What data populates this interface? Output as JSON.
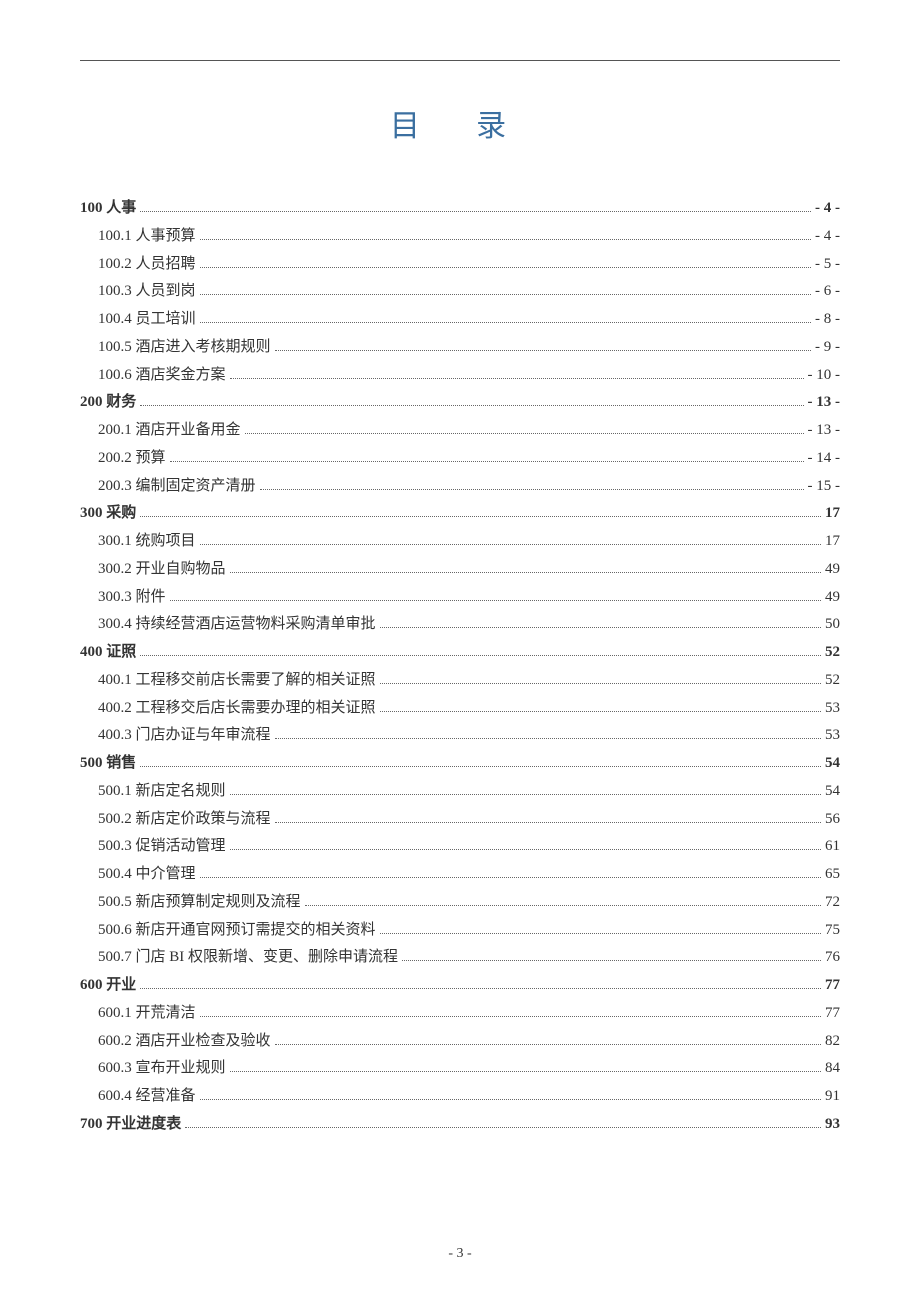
{
  "title": "目 录",
  "page_number": "- 3 -",
  "toc": [
    {
      "level": 0,
      "label": "100 人事",
      "page": "- 4 -"
    },
    {
      "level": 1,
      "label": "100.1 人事预算",
      "page": "- 4 -"
    },
    {
      "level": 1,
      "label": "100.2 人员招聘",
      "page": "- 5 -"
    },
    {
      "level": 1,
      "label": "100.3 人员到岗",
      "page": "- 6 -"
    },
    {
      "level": 1,
      "label": "100.4 员工培训",
      "page": "- 8 -"
    },
    {
      "level": 1,
      "label": "100.5 酒店进入考核期规则",
      "page": "- 9 -"
    },
    {
      "level": 1,
      "label": "100.6 酒店奖金方案",
      "page": "- 10 -"
    },
    {
      "level": 0,
      "label": "200 财务",
      "page": "- 13 -"
    },
    {
      "level": 1,
      "label": "200.1 酒店开业备用金",
      "page": "- 13 -"
    },
    {
      "level": 1,
      "label": "200.2 预算",
      "page": "- 14 -"
    },
    {
      "level": 1,
      "label": "200.3 编制固定资产清册",
      "page": "- 15 -"
    },
    {
      "level": 0,
      "label": "300 采购",
      "page": "17"
    },
    {
      "level": 1,
      "label": "300.1 统购项目",
      "page": "17"
    },
    {
      "level": 1,
      "label": "300.2 开业自购物品",
      "page": "49"
    },
    {
      "level": 1,
      "label": "300.3 附件",
      "page": "49"
    },
    {
      "level": 1,
      "label": "300.4 持续经营酒店运营物料采购清单审批",
      "page": "50"
    },
    {
      "level": 0,
      "label": "400 证照",
      "page": "52"
    },
    {
      "level": 1,
      "label": "400.1 工程移交前店长需要了解的相关证照",
      "page": "52"
    },
    {
      "level": 1,
      "label": "400.2 工程移交后店长需要办理的相关证照",
      "page": "53"
    },
    {
      "level": 1,
      "label": "400.3 门店办证与年审流程",
      "page": "53"
    },
    {
      "level": 0,
      "label": "500 销售",
      "page": "54"
    },
    {
      "level": 1,
      "label": "500.1 新店定名规则",
      "page": "54"
    },
    {
      "level": 1,
      "label": "500.2 新店定价政策与流程",
      "page": "56"
    },
    {
      "level": 1,
      "label": "500.3 促销活动管理",
      "page": "61"
    },
    {
      "level": 1,
      "label": "500.4 中介管理",
      "page": "65"
    },
    {
      "level": 1,
      "label": "500.5 新店预算制定规则及流程",
      "page": "72"
    },
    {
      "level": 1,
      "label": "500.6 新店开通官网预订需提交的相关资料",
      "page": "75"
    },
    {
      "level": 1,
      "label": "500.7 门店 BI 权限新增、变更、删除申请流程",
      "page": "76"
    },
    {
      "level": 0,
      "label": "600 开业",
      "page": "77"
    },
    {
      "level": 1,
      "label": "600.1 开荒清洁",
      "page": "77"
    },
    {
      "level": 1,
      "label": "600.2 酒店开业检查及验收",
      "page": "82"
    },
    {
      "level": 1,
      "label": "600.3 宣布开业规则",
      "page": "84"
    },
    {
      "level": 1,
      "label": "600.4 经营准备",
      "page": "91"
    },
    {
      "level": 0,
      "label": "700 开业进度表",
      "page": "93"
    }
  ]
}
